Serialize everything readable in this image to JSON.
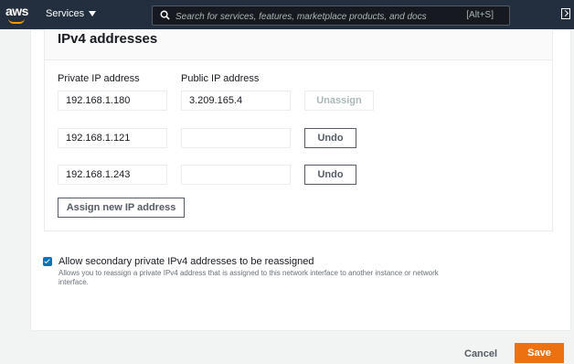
{
  "nav": {
    "logo_text": "aws",
    "services_label": "Services",
    "search_placeholder": "Search for services, features, marketplace products, and docs",
    "search_shortcut": "[Alt+S]",
    "brand_color": "#232f3e",
    "accent_color": "#ff9900"
  },
  "panel": {
    "title": "IPv4 addresses",
    "col_private": "Private IP address",
    "col_public": "Public IP address",
    "rows": [
      {
        "private_ip": "192.168.1.180",
        "public_ip": "3.209.165.4",
        "action": "Unassign",
        "action_disabled": true
      },
      {
        "private_ip": "192.168.1.121",
        "public_ip": "",
        "action": "Undo",
        "action_disabled": false
      },
      {
        "private_ip": "192.168.1.243",
        "public_ip": "",
        "action": "Undo",
        "action_disabled": false
      }
    ],
    "assign_button": "Assign new IP address"
  },
  "reassign": {
    "checked": true,
    "label": "Allow secondary private IPv4 addresses to be reassigned",
    "description": "Allows you to reassign a private IPv4 address that is assigned to this network interface to another instance or network interface."
  },
  "footer": {
    "cancel_label": "Cancel",
    "save_label": "Save",
    "save_color": "#ec7211"
  }
}
